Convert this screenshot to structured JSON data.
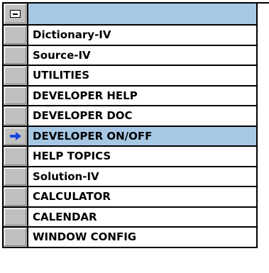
{
  "header": {
    "collapse_icon": "collapse-minus-icon",
    "title": ""
  },
  "colors": {
    "selection": "#a7c8e5",
    "selector_gray": "#c0c0c0",
    "pointer": "#1a47e0"
  },
  "rows": [
    {
      "label": "Dictionary-IV",
      "selected": false
    },
    {
      "label": "Source-IV",
      "selected": false
    },
    {
      "label": "UTILITIES",
      "selected": false
    },
    {
      "label": "DEVELOPER HELP",
      "selected": false
    },
    {
      "label": "DEVELOPER DOC",
      "selected": false
    },
    {
      "label": "DEVELOPER ON/OFF",
      "selected": true,
      "indicator_icon": "current-row-arrow-icon"
    },
    {
      "label": "HELP TOPICS",
      "selected": false
    },
    {
      "label": "Solution-IV",
      "selected": false
    },
    {
      "label": "CALCULATOR",
      "selected": false
    },
    {
      "label": "CALENDAR",
      "selected": false
    },
    {
      "label": "WINDOW CONFIG",
      "selected": false
    }
  ]
}
